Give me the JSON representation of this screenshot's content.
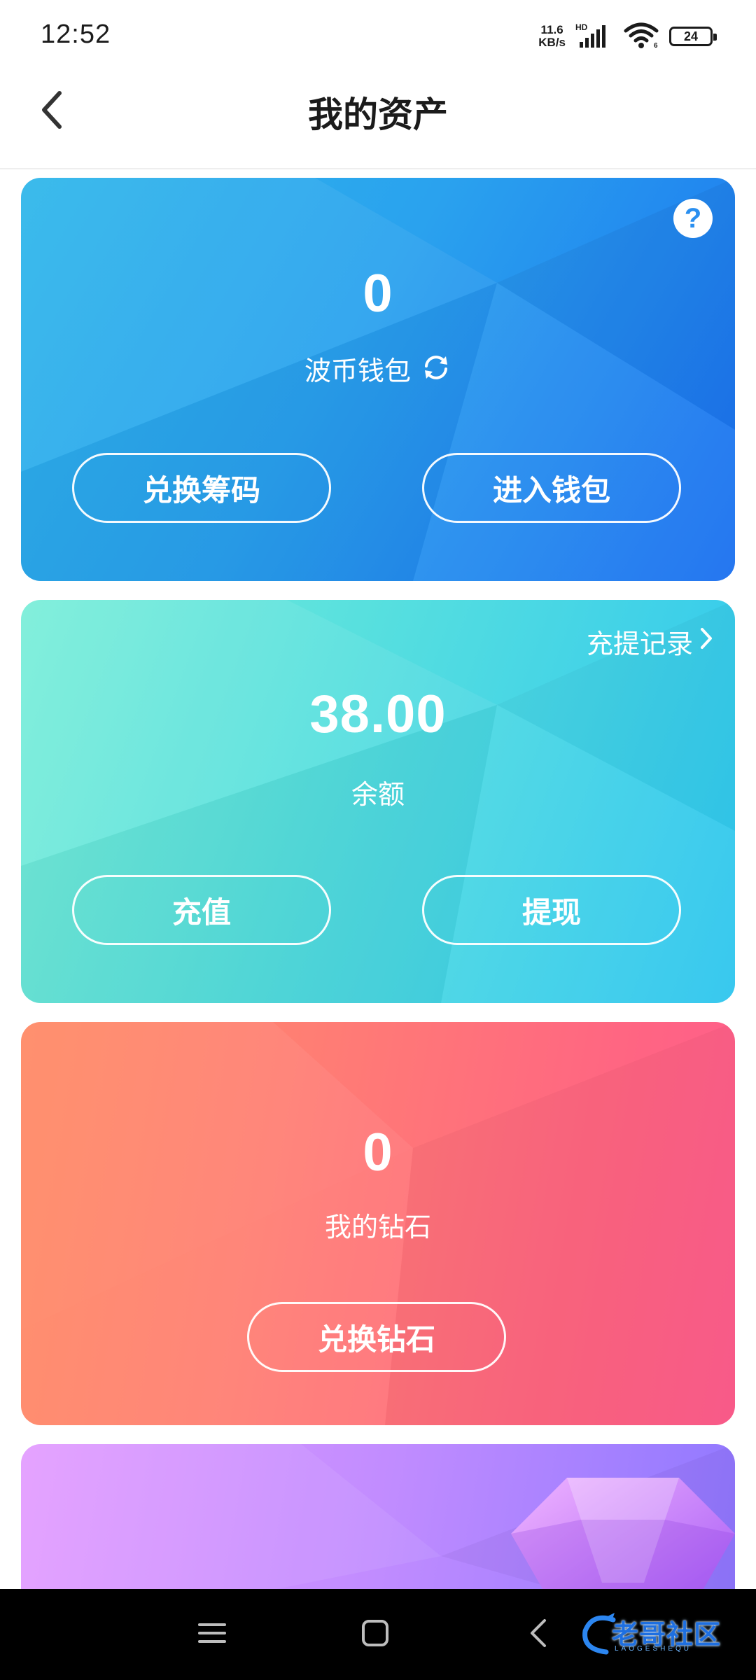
{
  "status_bar": {
    "time": "12:52",
    "net_speed_value": "11.6",
    "net_speed_unit": "KB/s",
    "network_type": "HD",
    "battery_level": "24",
    "icons": [
      "signal-icon",
      "wifi-icon",
      "battery-icon"
    ]
  },
  "header": {
    "title": "我的资产",
    "back_icon": "chevron-left-icon"
  },
  "bocoin_card": {
    "value": "0",
    "label": "波币钱包",
    "exchange_button": "兑换筹码",
    "wallet_button": "进入钱包",
    "help_symbol": "?",
    "refresh_icon": "refresh-icon"
  },
  "balance_card": {
    "record_link": "充提记录",
    "value": "38.00",
    "label": "余额",
    "recharge_button": "充值",
    "withdraw_button": "提现"
  },
  "diamond_card": {
    "value": "0",
    "label": "我的钻石",
    "exchange_button": "兑换钻石"
  },
  "gem_card": {
    "icon": "gem-icon"
  },
  "nav_bar": {
    "icons": [
      "menu-icon",
      "home-icon",
      "back-icon"
    ]
  },
  "watermark": {
    "text": "老哥社区",
    "subtext": "LAOGESHEQU"
  },
  "colors": {
    "bocoin_gradient": [
      "#2fb7ea",
      "#1a6ff0"
    ],
    "balance_gradient": [
      "#7aeed9",
      "#2ec6ef"
    ],
    "diamond_gradient": [
      "#ff8a65",
      "#ff5e8e"
    ],
    "gem_gradient": [
      "#e39cff",
      "#8f78ff"
    ]
  }
}
